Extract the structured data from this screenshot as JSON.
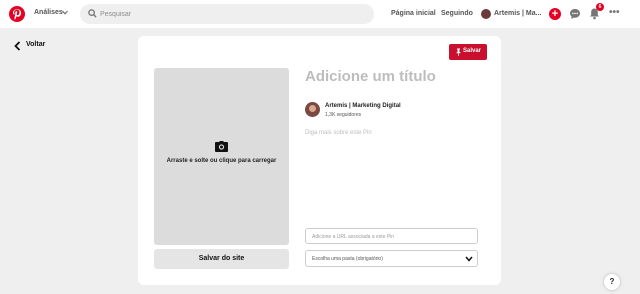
{
  "topbar": {
    "analytics_label": "Análises",
    "search_placeholder": "Pesquisar",
    "home_label": "Página inicial",
    "following_label": "Seguindo",
    "profile_label": "Artemis | Ma...",
    "notifications_count": "6",
    "brand_color": "#e60023"
  },
  "back": {
    "label": "Voltar"
  },
  "card": {
    "save_label": "Salvar",
    "upload_text": "Arraste e solte ou clique para carregar",
    "save_from_site_label": "Salvar do site",
    "title_placeholder": "Adicione um título",
    "author_name": "Artemis | Marketing Digital",
    "author_followers": "1,3K seguidores",
    "description_placeholder": "Diga mais sobre este Pin",
    "url_placeholder": "Adicione a URL associada a este Pin",
    "board_placeholder": "Escolha uma pasta (obrigatório)"
  },
  "help": {
    "label": "?"
  }
}
